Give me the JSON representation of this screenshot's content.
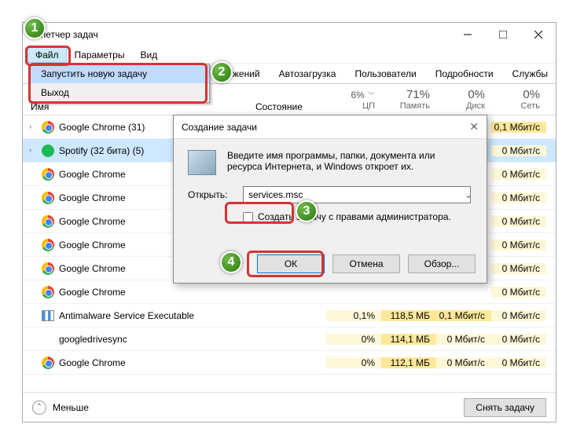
{
  "window": {
    "title": "испетчер задач",
    "menu": {
      "file": "Файл",
      "options": "Параметры",
      "view": "Вид"
    },
    "dropdown": {
      "new_task": "Запустить новую задачу",
      "exit": "Выход"
    },
    "tabs": {
      "apps": "ложений",
      "startup": "Автозагрузка",
      "users": "Пользователи",
      "details": "Подробности",
      "services": "Службы"
    },
    "columns": {
      "name": "Имя",
      "state": "Состояние",
      "cpu": {
        "pct": "6%",
        "label": "ЦП"
      },
      "mem": {
        "pct": "71%",
        "label": "Память"
      },
      "disk": {
        "pct": "0%",
        "label": "Диск"
      },
      "net": {
        "pct": "0%",
        "label": "Сеть"
      }
    },
    "rows": [
      {
        "icon": "chrome",
        "name": "Google Chrome (31)",
        "exp": true,
        "cpu": "",
        "mem": "",
        "disk": "",
        "net": "0,1 Мбит/с",
        "nethot": true
      },
      {
        "icon": "spotify",
        "name": "Spotify (32 бита) (5)",
        "exp": true,
        "sel": true,
        "cpu": "",
        "mem": "",
        "disk": "",
        "net": "0 Мбит/с"
      },
      {
        "icon": "chrome",
        "name": "Google Chrome",
        "cpu": "",
        "mem": "",
        "disk": "",
        "net": "0 Мбит/с"
      },
      {
        "icon": "chrome",
        "name": "Google Chrome",
        "cpu": "",
        "mem": "",
        "disk": "",
        "net": "0 Мбит/с"
      },
      {
        "icon": "chrome",
        "name": "Google Chrome",
        "cpu": "",
        "mem": "",
        "disk": "",
        "net": "0 Мбит/с"
      },
      {
        "icon": "chrome",
        "name": "Google Chrome",
        "cpu": "",
        "mem": "",
        "disk": "",
        "net": "0 Мбит/с"
      },
      {
        "icon": "chrome",
        "name": "Google Chrome",
        "cpu": "",
        "mem": "",
        "disk": "",
        "net": "0 Мбит/с"
      },
      {
        "icon": "chrome",
        "name": "Google Chrome",
        "cpu": "",
        "mem": "",
        "disk": "",
        "net": "0 Мбит/с"
      },
      {
        "icon": "am",
        "name": "Antimalware Service Executable",
        "cpu": "0,1%",
        "mem": "118,5 МБ",
        "disk": "0,1 Мбит/с",
        "net": "0 Мбит/с",
        "memhot": true,
        "diskhot": true
      },
      {
        "icon": "",
        "name": "googledrivesync",
        "cpu": "0%",
        "mem": "114,1 МБ",
        "disk": "0 Мбит/с",
        "net": "0 Мбит/с",
        "memhot": true
      },
      {
        "icon": "chrome",
        "name": "Google Chrome",
        "cpu": "0%",
        "mem": "112,1 МБ",
        "disk": "0 Мбит/с",
        "net": "0 Мбит/с",
        "memhot": true
      }
    ],
    "footer": {
      "fewer": "Меньше",
      "end_task": "Снять задачу"
    }
  },
  "dialog": {
    "title": "Создание задачи",
    "desc": "Введите имя программы, папки, документа или ресурса Интернета, и Windows откроет их.",
    "open_label": "Открыть:",
    "open_value": "services.msc",
    "admin_label": "Создать задачу с правами администратора.",
    "ok": "ОК",
    "cancel": "Отмена",
    "browse": "Обзор..."
  },
  "callouts": {
    "c1": "1",
    "c2": "2",
    "c3": "3",
    "c4": "4"
  }
}
